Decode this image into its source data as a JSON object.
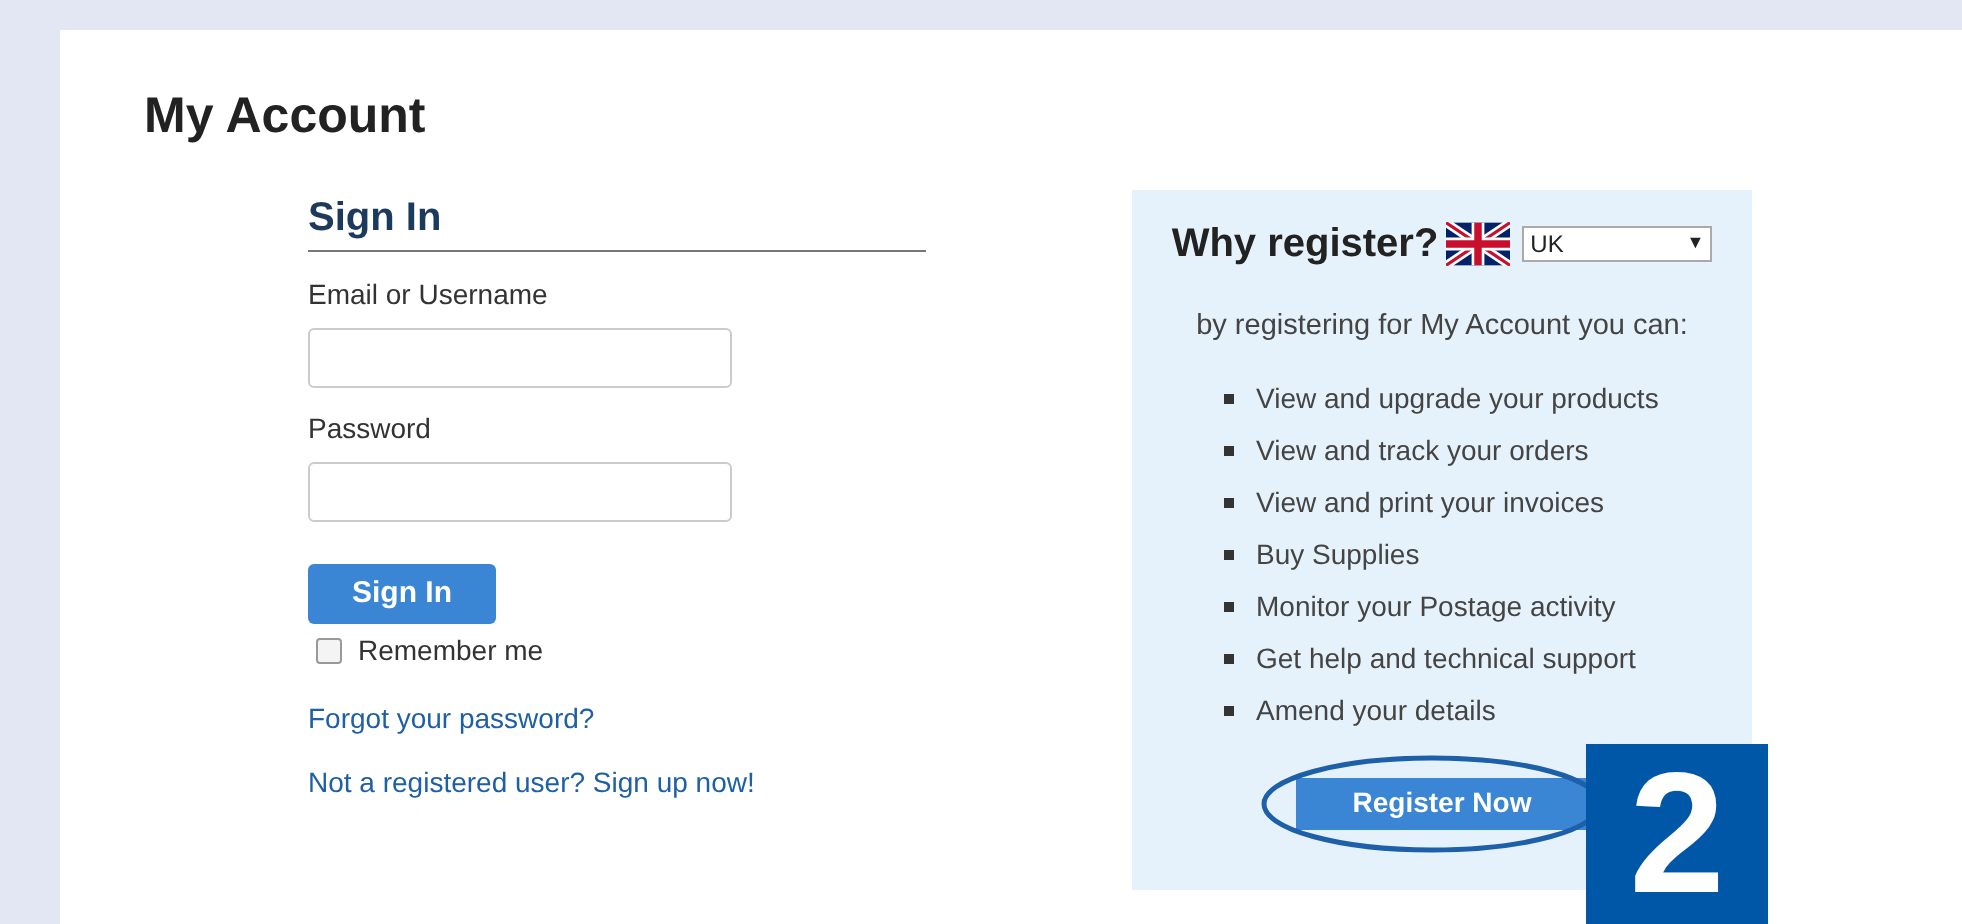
{
  "page_title": "My Account",
  "sign_in": {
    "heading": "Sign In",
    "fields": [
      {
        "label": "Email or Username"
      },
      {
        "label": "Password"
      }
    ],
    "button": "Sign In",
    "remember": {
      "label": "Remember me",
      "checked": false
    },
    "links": [
      "Forgot your password?",
      "Not a registered user? Sign up now!"
    ]
  },
  "register_panel": {
    "heading": "Why register?",
    "country": "UK",
    "caret": "▼",
    "intro": "by registering for My Account you can:",
    "benefits": [
      "View and upgrade your products",
      "View and track your orders",
      "View and print your invoices",
      "Buy Supplies",
      "Monitor your Postage activity",
      "Get help and technical support",
      "Amend your details"
    ],
    "button": "Register Now"
  },
  "step_badge": "2"
}
